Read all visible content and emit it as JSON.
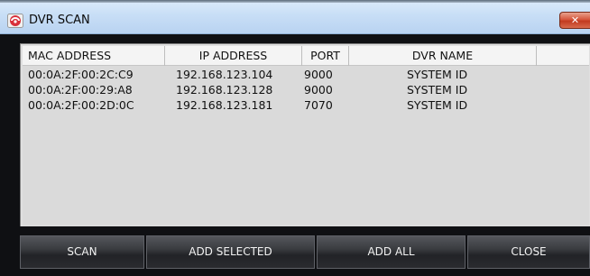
{
  "window": {
    "title": "DVR SCAN",
    "close_glyph": "✕",
    "icon": "dvr-app-icon"
  },
  "table": {
    "headers": {
      "mac": "MAC ADDRESS",
      "ip": "IP ADDRESS",
      "port": "PORT",
      "name": "DVR NAME",
      "extra": ""
    },
    "rows": [
      {
        "mac": "00:0A:2F:00:2C:C9",
        "ip": "192.168.123.104",
        "port": "9000",
        "name": "SYSTEM ID"
      },
      {
        "mac": "00:0A:2F:00:29:A8",
        "ip": "192.168.123.128",
        "port": "9000",
        "name": "SYSTEM ID"
      },
      {
        "mac": "00:0A:2F:00:2D:0C",
        "ip": "192.168.123.181",
        "port": "7070",
        "name": "SYSTEM ID"
      }
    ]
  },
  "buttons": {
    "scan": "SCAN",
    "add_selected": "ADD SELECTED",
    "add_all": "ADD ALL",
    "close": "CLOSE"
  },
  "colors": {
    "close_button": "#d6573d",
    "dialog_background": "#0f1013",
    "button_background": "#2e3034"
  }
}
